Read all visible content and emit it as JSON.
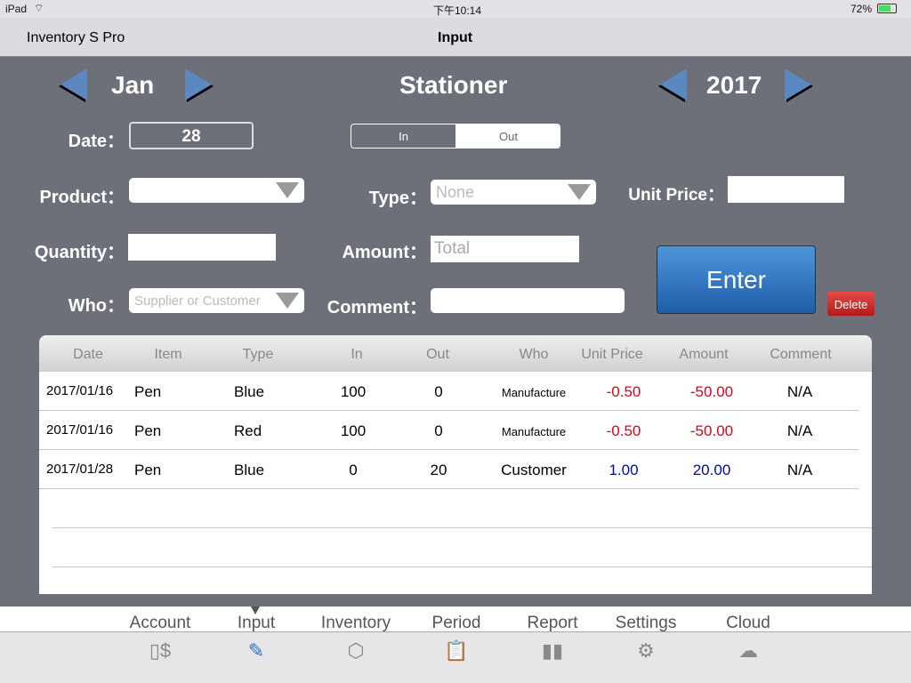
{
  "status": {
    "device": "iPad",
    "time": "下午10:14",
    "battery": "72%"
  },
  "nav": {
    "app_name": "Inventory S Pro",
    "title": "Input"
  },
  "header": {
    "month": "Jan",
    "store": "Stationer",
    "year": "2017"
  },
  "form": {
    "date_label": "Date：",
    "date_value": "28",
    "segment": {
      "in": "In",
      "out": "Out",
      "selected": "Out"
    },
    "product_label": "Product：",
    "product_value": "",
    "type_label": "Type：",
    "type_placeholder": "None",
    "unit_price_label": "Unit Price：",
    "unit_price_value": "",
    "quantity_label": "Quantity：",
    "quantity_value": "",
    "amount_label": "Amount：",
    "amount_placeholder": "Total",
    "who_label": "Who：",
    "who_placeholder": "Supplier or Customer",
    "comment_label": "Comment：",
    "comment_value": "",
    "enter_label": "Enter",
    "delete_label": "Delete"
  },
  "table": {
    "headers": [
      "Date",
      "Item",
      "Type",
      "In",
      "Out",
      "Who",
      "Unit Price",
      "Amount",
      "Comment"
    ],
    "rows": [
      {
        "date": "2017/01/16",
        "item": "Pen",
        "type": "Blue",
        "in": "100",
        "out": "0",
        "who": "Manufacture",
        "unit_price": "-0.50",
        "amount": "-50.00",
        "comment": "N/A"
      },
      {
        "date": "2017/01/16",
        "item": "Pen",
        "type": "Red",
        "in": "100",
        "out": "0",
        "who": "Manufacture",
        "unit_price": "-0.50",
        "amount": "-50.00",
        "comment": "N/A"
      },
      {
        "date": "2017/01/28",
        "item": "Pen",
        "type": "Blue",
        "in": "0",
        "out": "20",
        "who": "Customer",
        "unit_price": "1.00",
        "amount": "20.00",
        "comment": "N/A"
      }
    ]
  },
  "colors": {
    "negative": "#e0001b",
    "positive": "#0000cc",
    "accent": "#2a73c8",
    "background": "#6d7079"
  },
  "tabs": [
    {
      "label": "Account",
      "icon": "account-icon"
    },
    {
      "label": "Input",
      "icon": "input-icon",
      "active": true
    },
    {
      "label": "Inventory",
      "icon": "box-icon"
    },
    {
      "label": "Period",
      "icon": "clipboard-icon"
    },
    {
      "label": "Report",
      "icon": "chart-icon"
    },
    {
      "label": "Settings",
      "icon": "gears-icon"
    },
    {
      "label": "Cloud",
      "icon": "cloud-icon"
    }
  ]
}
